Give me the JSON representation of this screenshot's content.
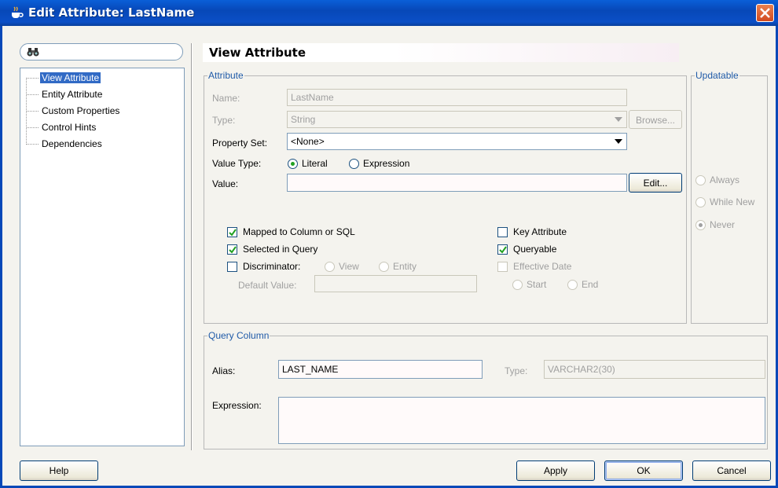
{
  "window": {
    "title": "Edit Attribute: LastName"
  },
  "tree": {
    "items": [
      {
        "label": "View Attribute",
        "selected": true
      },
      {
        "label": "Entity Attribute"
      },
      {
        "label": "Custom Properties"
      },
      {
        "label": "Control Hints"
      },
      {
        "label": "Dependencies"
      }
    ]
  },
  "header": {
    "title": "View Attribute"
  },
  "attribute": {
    "group_title": "Attribute",
    "name_label": "Name:",
    "name_value": "LastName",
    "type_label": "Type:",
    "type_value": "String",
    "browse_label": "Browse...",
    "property_set_label": "Property Set:",
    "property_set_value": "<None>",
    "value_type_label": "Value Type:",
    "value_type_literal": "Literal",
    "value_type_expression": "Expression",
    "value_type_selected": "Literal",
    "value_label": "Value:",
    "value_value": "",
    "edit_label": "Edit...",
    "mapped_label": "Mapped to Column or SQL",
    "mapped_checked": true,
    "selected_query_label": "Selected in Query",
    "selected_query_checked": true,
    "discriminator_label": "Discriminator:",
    "discriminator_checked": false,
    "disc_view": "View",
    "disc_entity": "Entity",
    "default_value_label": "Default Value:",
    "default_value_value": "",
    "key_attribute_label": "Key Attribute",
    "key_attribute_checked": false,
    "queryable_label": "Queryable",
    "queryable_checked": true,
    "effective_date_label": "Effective Date",
    "effective_date_checked": false,
    "eff_start": "Start",
    "eff_end": "End"
  },
  "updatable": {
    "group_title": "Updatable",
    "always": "Always",
    "while_new": "While New",
    "never": "Never",
    "selected": "Never"
  },
  "query_column": {
    "group_title": "Query Column",
    "alias_label": "Alias:",
    "alias_value": "LAST_NAME",
    "type_label": "Type:",
    "type_value": "VARCHAR2(30)",
    "expression_label": "Expression:",
    "expression_value": ""
  },
  "buttons": {
    "help": "Help",
    "apply": "Apply",
    "ok": "OK",
    "cancel": "Cancel"
  },
  "colors": {
    "titlebar": "#0748b8",
    "group_title": "#1f5aa8",
    "selection": "#316ac5",
    "check": "#21a121"
  }
}
